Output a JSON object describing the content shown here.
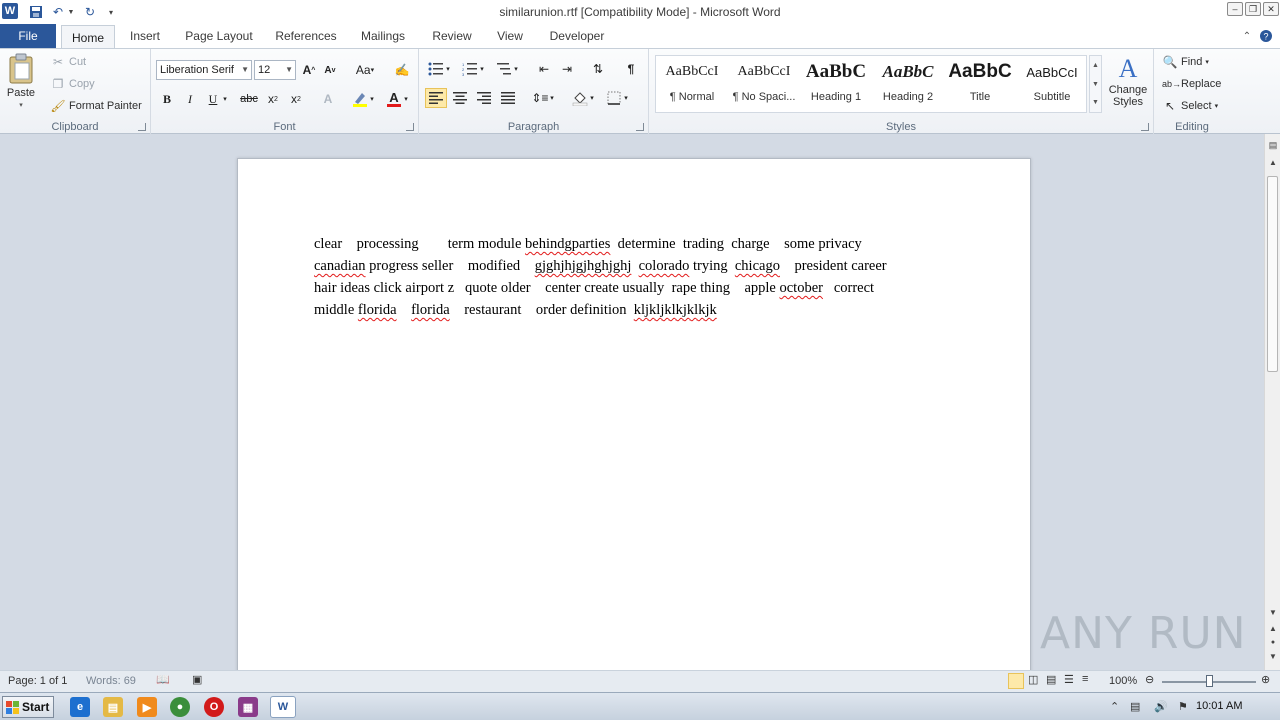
{
  "window": {
    "title": "similarunion.rtf [Compatibility Mode]  -  Microsoft Word",
    "app_icon": "W"
  },
  "tabs": [
    {
      "label": "File"
    },
    {
      "label": "Home"
    },
    {
      "label": "Insert"
    },
    {
      "label": "Page Layout"
    },
    {
      "label": "References"
    },
    {
      "label": "Mailings"
    },
    {
      "label": "Review"
    },
    {
      "label": "View"
    },
    {
      "label": "Developer"
    }
  ],
  "ribbon": {
    "clipboard": {
      "label": "Clipboard",
      "paste": "Paste",
      "cut": "Cut",
      "copy": "Copy",
      "format_painter": "Format Painter"
    },
    "font": {
      "label": "Font",
      "font_name": "Liberation Serif",
      "font_size": "12",
      "change_case": "Aa"
    },
    "paragraph": {
      "label": "Paragraph"
    },
    "styles": {
      "label": "Styles",
      "items": [
        {
          "sample": "AaBbCcI",
          "name": "¶ Normal"
        },
        {
          "sample": "AaBbCcI",
          "name": "¶ No Spaci..."
        },
        {
          "sample": "AaBbC",
          "name": "Heading 1"
        },
        {
          "sample": "AaBbC",
          "name": "Heading 2"
        },
        {
          "sample": "AaBbC",
          "name": "Title"
        },
        {
          "sample": "AaBbCcI",
          "name": "Subtitle"
        }
      ],
      "change_styles": "Change Styles"
    },
    "editing": {
      "label": "Editing",
      "find": "Find",
      "replace": "Replace",
      "select": "Select"
    }
  },
  "document": {
    "lines": [
      "clear    processing        term module behindgparties  determine  trading  charge    some privacy",
      "canadian progress seller    modified    gjghjhjgjhghjghj  colorado trying  chicago    president career",
      "hair ideas click airport z   quote older    center create usually  rape thing    apple october   correct",
      "middle florida    florida    restaurant    order definition  kljkljklkjklkjk"
    ]
  },
  "status": {
    "page": "Page: 1 of 1",
    "words": "Words: 69",
    "zoom": "100%"
  },
  "taskbar": {
    "start": "Start",
    "clock": "10:01 AM"
  },
  "watermark": "ANY RUN",
  "colors": {
    "accent": "#2b579a",
    "workspace": "#d3dae4",
    "spellcheck": "#e21a1a"
  }
}
